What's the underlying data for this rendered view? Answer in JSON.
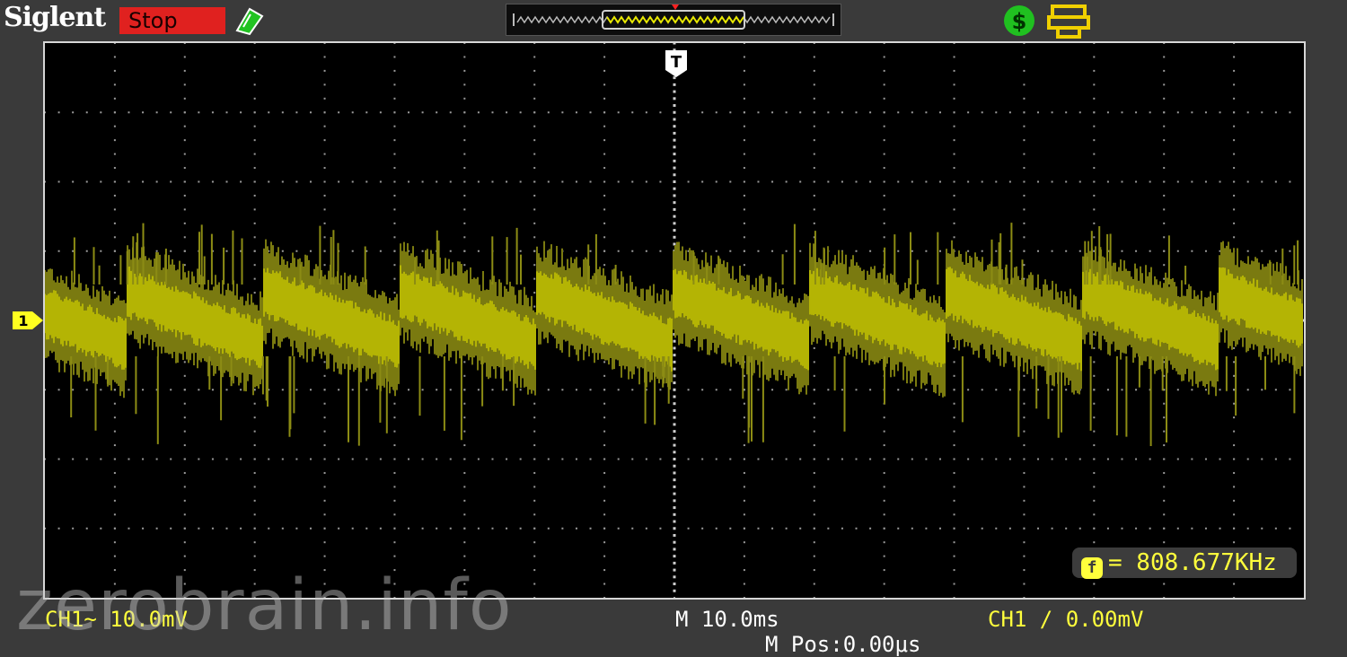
{
  "header": {
    "brand": "Siglent",
    "run_state": "Stop",
    "status_color": "#e0211f"
  },
  "icons": {
    "trigger_status": "trigger-ready-icon",
    "usb": "usb-icon",
    "printer": "printer-icon"
  },
  "screen": {
    "trigger_marker": "T",
    "channel_marker": "1",
    "trace_color": "#c8c800"
  },
  "measurement": {
    "label": "f",
    "value": "= 808.677KHz"
  },
  "footer": {
    "ch1_scale": "CH1~ 10.0mV",
    "timebase": "M 10.0ms",
    "trigger_setting": "CH1 ∕ 0.00mV",
    "m_pos": "M Pos:0.00μs"
  },
  "watermark": "zerobrain.info"
}
